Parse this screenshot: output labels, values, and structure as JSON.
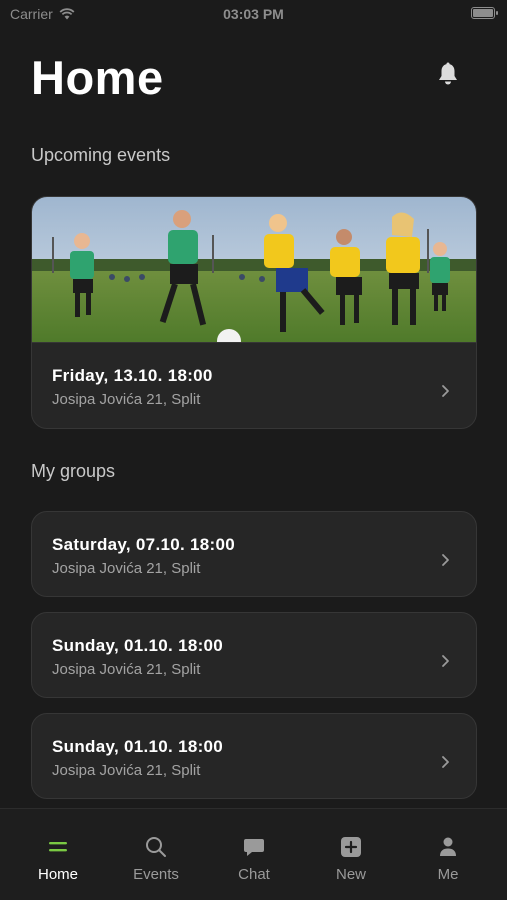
{
  "status": {
    "carrier": "Carrier",
    "time": "03:03 PM"
  },
  "header": {
    "title": "Home"
  },
  "upcoming": {
    "section_title": "Upcoming events",
    "event": {
      "title": "Friday, 13.10. 18:00",
      "location": "Josipa Jovića 21, Split"
    }
  },
  "groups": {
    "section_title": "My groups",
    "items": [
      {
        "title": "Saturday, 07.10. 18:00",
        "location": "Josipa Jovića 21, Split"
      },
      {
        "title": "Sunday, 01.10. 18:00",
        "location": "Josipa Jovića 21, Split"
      },
      {
        "title": "Sunday, 01.10. 18:00",
        "location": "Josipa Jovića 21, Split"
      }
    ]
  },
  "tabbar": {
    "items": [
      {
        "label": "Home",
        "icon": "menu-icon",
        "active": true
      },
      {
        "label": "Events",
        "icon": "search-icon",
        "active": false
      },
      {
        "label": "Chat",
        "icon": "chat-icon",
        "active": false
      },
      {
        "label": "New",
        "icon": "plus-square-icon",
        "active": false
      },
      {
        "label": "Me",
        "icon": "person-icon",
        "active": false
      }
    ]
  },
  "colors": {
    "background": "#1b1b1b",
    "card": "#262626",
    "accent": "#7ac943"
  }
}
